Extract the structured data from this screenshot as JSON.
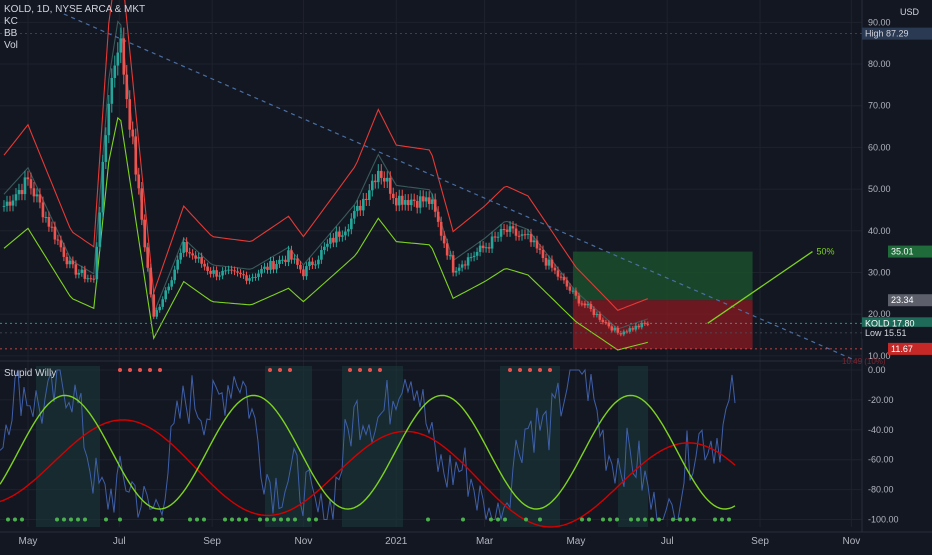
{
  "header": {
    "symbol_line": "KOLD, 1D, NYSE ARCA & MKT",
    "indicators": [
      "KC",
      "BB",
      "Vol"
    ],
    "currency": "USD"
  },
  "subpanel": {
    "title": "Stupid Willy"
  },
  "badges": {
    "high": {
      "label": "High",
      "value": "87.29"
    },
    "target": {
      "value": "35.01"
    },
    "gray": {
      "value": "23.34"
    },
    "last": {
      "label": "KOLD",
      "value": "17.80"
    },
    "low": {
      "label": "Low",
      "value": "15.51"
    },
    "stop": {
      "value": "11.67"
    }
  },
  "annotations": {
    "pct": "50%",
    "faded": "10.49 (10%)"
  },
  "colors": {
    "background": "#131722",
    "candle_up": "#26a69a",
    "candle_down": "#ef5350",
    "upper_band": "#e53935",
    "lower_band": "#7ed321",
    "trendline": "#4a6fa5",
    "target_zone": "#1b4d2b",
    "stop_zone": "#8b1a22",
    "osc_line": "#3f5fa8",
    "osc_fast": "#7ed321",
    "osc_slow": "#d50000"
  },
  "chart_data": [
    {
      "type": "line",
      "title": "KOLD, 1D, NYSE ARCA & MKT",
      "x_ticks": [
        "May",
        "Jul",
        "Sep",
        "Nov",
        "2021",
        "Mar",
        "May",
        "Jul",
        "Sep",
        "Nov"
      ],
      "y_ticks": [
        "90.00",
        "80.00",
        "70.00",
        "60.00",
        "50.00",
        "40.00",
        "30.00",
        "20.00",
        "10.00"
      ],
      "ylim": [
        9,
        92
      ],
      "series": [
        {
          "values_by_tick": {
            "start": 52,
            "May": 31,
            "Jun": 28,
            "mid_Jun": 72,
            "late_Jun": 87.29,
            "Jul": 19,
            "early_Aug": 36,
            "mid_Aug": 30,
            "Sep": 29,
            "early_Oct": 32,
            "Oct": 34,
            "mid_Oct": 30,
            "Nov": 36,
            "late_Nov": 44,
            "Dec": 55,
            "mid_Dec": 48,
            "2021": 46,
            "early_Feb": 47,
            "mid_Feb": 31,
            "Mar": 36,
            "mid_Mar": 40,
            "Apr": 38,
            "early_Jul": 24,
            "Aug": 15.51,
            "end": 17.8
          }
        }
      ],
      "levels": {
        "high": 87.29,
        "target": 35.01,
        "entry_gray": 23.34,
        "last": 17.8,
        "low": 15.51,
        "stop": 11.67
      },
      "grid": true
    },
    {
      "type": "line",
      "title": "Stupid Willy",
      "y_ticks": [
        "0.00",
        "-20.00",
        "-40.00",
        "-60.00",
        "-80.00",
        "-100.00"
      ],
      "ylim": [
        -105,
        4
      ],
      "grid": true
    }
  ]
}
